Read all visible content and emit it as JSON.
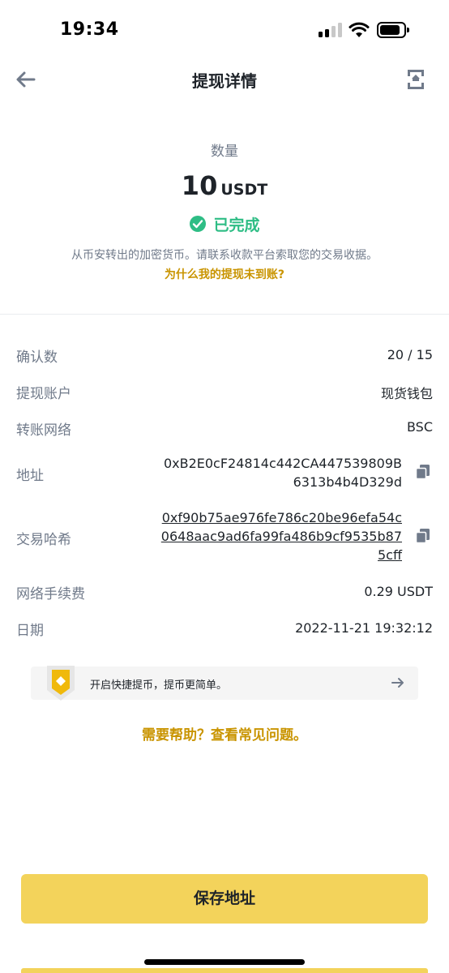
{
  "status_bar": {
    "time": "19:34"
  },
  "header": {
    "title": "提现详情",
    "back_icon": "arrow-left-icon",
    "share_icon": "share-icon"
  },
  "summary": {
    "amount_label": "数量",
    "amount_value": "10",
    "amount_unit": "USDT",
    "status": "已完成",
    "note": "从币安转出的加密货币。请联系收款平台索取您的交易收据。",
    "why_link": "为什么我的提现未到账?"
  },
  "details": {
    "confirmations_label": "确认数",
    "confirmations_value": "20 / 15",
    "account_label": "提现账户",
    "account_value": "现货钱包",
    "network_label": "转账网络",
    "network_value": "BSC",
    "address_label": "地址",
    "address_value": "0xB2E0cF24814c442CA447539809B6313b4b4D329d",
    "txid_label": "交易哈希",
    "txid_value": "0xf90b75ae976fe786c20be96efa54c0648aac9ad6fa99fa486b9cf9535b875cff",
    "fee_label": "网络手续费",
    "fee_value": "0.29 USDT",
    "date_label": "日期",
    "date_value": "2022-11-21 19:32:12"
  },
  "banner": {
    "text": "开启快捷提币，提币更简单。"
  },
  "help_link": "需要帮助？查看常见问题。",
  "save_button": "保存地址",
  "colors": {
    "accent": "#c99400",
    "button": "#f3d35b",
    "success": "#2ebd85"
  }
}
